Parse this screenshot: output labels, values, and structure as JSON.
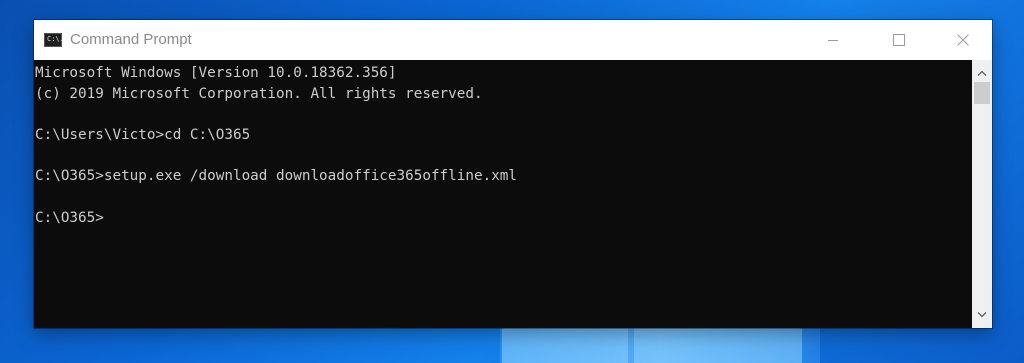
{
  "window": {
    "title": "Command Prompt",
    "icon": "cmd-icon",
    "icon_glyph": "C:\\."
  },
  "title_controls": {
    "minimize_icon": "minimize-icon",
    "maximize_icon": "maximize-icon",
    "close_icon": "close-icon"
  },
  "console": {
    "lines": [
      "Microsoft Windows [Version 10.0.18362.356]",
      "(c) 2019 Microsoft Corporation. All rights reserved.",
      "",
      "C:\\Users\\Victo>cd C:\\O365",
      "",
      "C:\\O365>setup.exe /download downloadoffice365offline.xml",
      "",
      "C:\\O365>"
    ],
    "text_color": "#cccccc",
    "background": "#0c0c0c"
  },
  "scrollbar": {
    "up_icon": "scroll-up-icon",
    "down_icon": "scroll-down-icon"
  },
  "colors": {
    "desktop": "#0b66d4",
    "titlebar": "#ffffff",
    "title_text": "#8a8a8a"
  }
}
